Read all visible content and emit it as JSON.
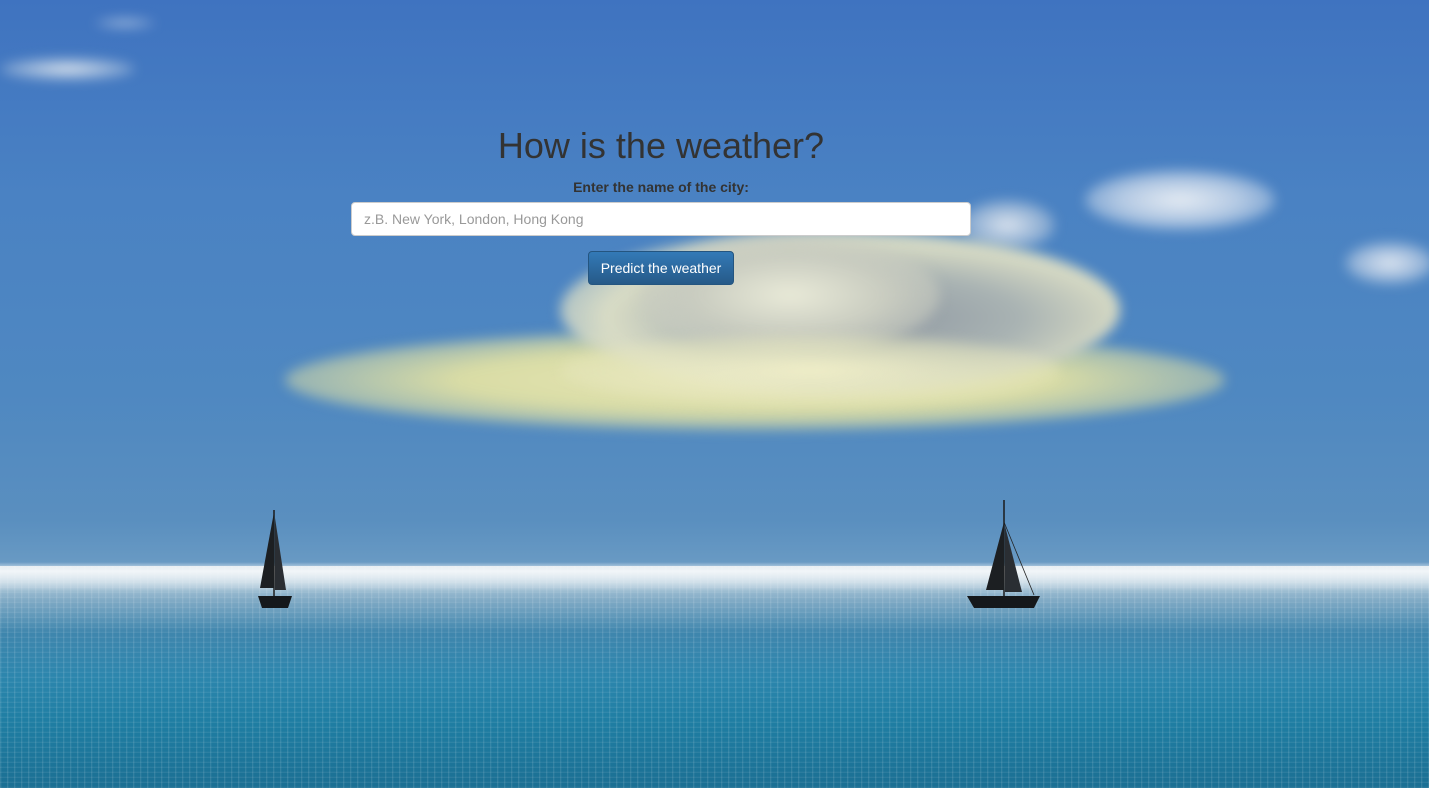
{
  "page": {
    "title": "How is the weather?"
  },
  "form": {
    "city_label": "Enter the name of the city:",
    "city_input": {
      "value": "",
      "placeholder": "z.B. New York, London, Hong Kong"
    },
    "submit_label": "Predict the weather"
  },
  "background": {
    "scene": "sky-cloud-sea-sailboats",
    "sky_color": "#4a82c3",
    "sea_color": "#2c86ad"
  },
  "colors": {
    "text": "#333333",
    "button_bg": "#337ab7",
    "button_text": "#ffffff"
  }
}
